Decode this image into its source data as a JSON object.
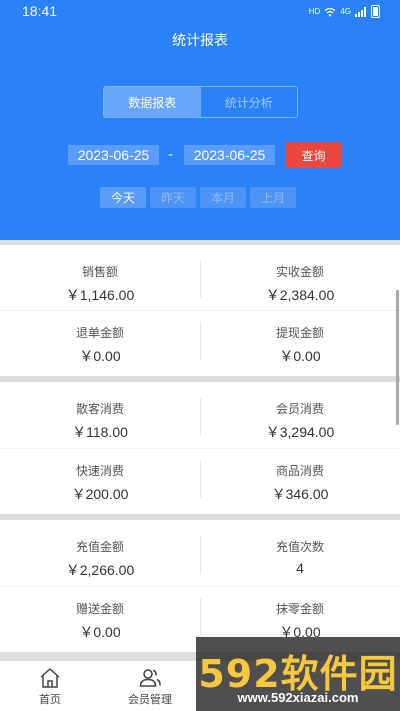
{
  "status_bar": {
    "time": "18:41",
    "hd": "HD",
    "network": "4G"
  },
  "page_title": "统计报表",
  "segment_tabs": [
    {
      "label": "数据报表",
      "active": true
    },
    {
      "label": "统计分析",
      "active": false
    }
  ],
  "date_range": {
    "start": "2023-06-25",
    "separator": "-",
    "end": "2023-06-25"
  },
  "query_button": "查询",
  "quick_ranges": [
    {
      "label": "今天",
      "active": true
    },
    {
      "label": "昨天",
      "active": false
    },
    {
      "label": "本月",
      "active": false
    },
    {
      "label": "上月",
      "active": false
    }
  ],
  "stats": {
    "sales": {
      "label": "销售额",
      "value": "￥1,146.00"
    },
    "received": {
      "label": "实收金额",
      "value": "￥2,384.00"
    },
    "refund": {
      "label": "退单金额",
      "value": "￥0.00"
    },
    "withdraw": {
      "label": "提现金额",
      "value": "￥0.00"
    },
    "walkin": {
      "label": "散客消费",
      "value": "￥118.00"
    },
    "member": {
      "label": "会员消费",
      "value": "￥3,294.00"
    },
    "quick": {
      "label": "快速消费",
      "value": "￥200.00"
    },
    "goods": {
      "label": "商品消费",
      "value": "￥346.00"
    },
    "recharge_amount": {
      "label": "充值金额",
      "value": "￥2,266.00"
    },
    "recharge_count": {
      "label": "充值次数",
      "value": "4"
    },
    "gift": {
      "label": "赠送金额",
      "value": "￥0.00"
    },
    "rounding": {
      "label": "抹零金额",
      "value": "￥0.00"
    }
  },
  "tabbar": [
    {
      "label": "首页",
      "icon": "home-icon"
    },
    {
      "label": "会员管理",
      "icon": "members-icon"
    }
  ],
  "watermark": {
    "brand": "592软件园",
    "url": "www.592xiazai.com"
  },
  "colors": {
    "primary": "#2b82f6",
    "query": "#e8483f",
    "watermark_yellow": "#f7c73f"
  }
}
